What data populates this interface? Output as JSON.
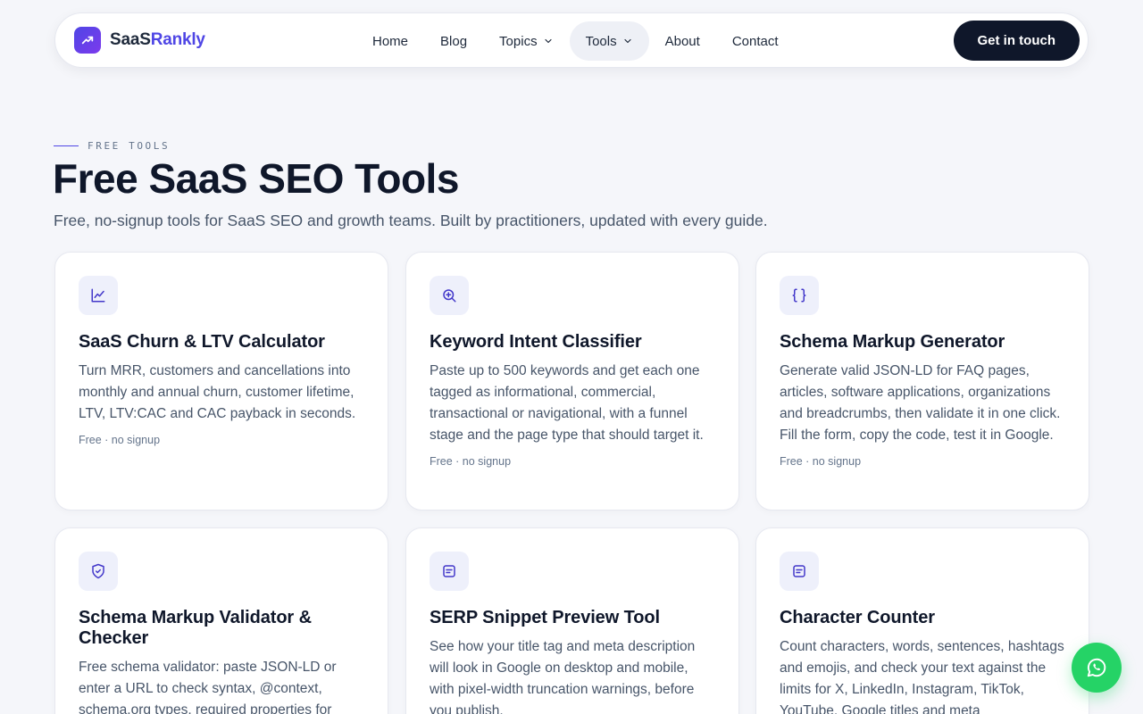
{
  "brand": {
    "name_part1": "SaaS",
    "name_part2": "Rankly",
    "logo_icon": "trending-up-icon",
    "accent_color": "#4f46e5"
  },
  "nav": {
    "items": [
      {
        "label": "Home",
        "dropdown": false,
        "active": false
      },
      {
        "label": "Blog",
        "dropdown": false,
        "active": false
      },
      {
        "label": "Topics",
        "dropdown": true,
        "active": false
      },
      {
        "label": "Tools",
        "dropdown": true,
        "active": true
      },
      {
        "label": "About",
        "dropdown": false,
        "active": false
      },
      {
        "label": "Contact",
        "dropdown": false,
        "active": false
      }
    ],
    "cta_label": "Get in touch"
  },
  "hero": {
    "eyebrow": "FREE TOOLS",
    "title": "Free SaaS SEO Tools",
    "subtitle": "Free, no-signup tools for SaaS SEO and growth teams. Built by practitioners, updated with every guide."
  },
  "tools": [
    {
      "icon": "line-chart-icon",
      "title": "SaaS Churn & LTV Calculator",
      "description": "Turn MRR, customers and cancellations into monthly and annual churn, customer lifetime, LTV, LTV:CAC and CAC payback in seconds.",
      "meta": "Free · no signup"
    },
    {
      "icon": "zoom-in-icon",
      "title": "Keyword Intent Classifier",
      "description": "Paste up to 500 keywords and get each one tagged as informational, commercial, transactional or navigational, with a funnel stage and the page type that should target it.",
      "meta": "Free · no signup"
    },
    {
      "icon": "braces-icon",
      "title": "Schema Markup Generator",
      "description": "Generate valid JSON-LD for FAQ pages, articles, software applications, organizations and breadcrumbs, then validate it in one click. Fill the form, copy the code, test it in Google.",
      "meta": "Free · no signup"
    },
    {
      "icon": "shield-check-icon",
      "title": "Schema Markup Validator & Checker",
      "description": "Free schema validator: paste JSON-LD or enter a URL to check syntax, @context, schema.org types, required properties for",
      "meta": ""
    },
    {
      "icon": "document-icon",
      "title": "SERP Snippet Preview Tool",
      "description": "See how your title tag and meta description will look in Google on desktop and mobile, with pixel-width truncation warnings, before you publish.",
      "meta": ""
    },
    {
      "icon": "document-icon",
      "title": "Character Counter",
      "description": "Count characters, words, sentences, hashtags and emojis, and check your text against the limits for X, LinkedIn, Instagram, TikTok, YouTube, Google titles and meta",
      "meta": ""
    }
  ],
  "floating_button": {
    "icon": "whatsapp-icon",
    "color": "#25d366"
  }
}
